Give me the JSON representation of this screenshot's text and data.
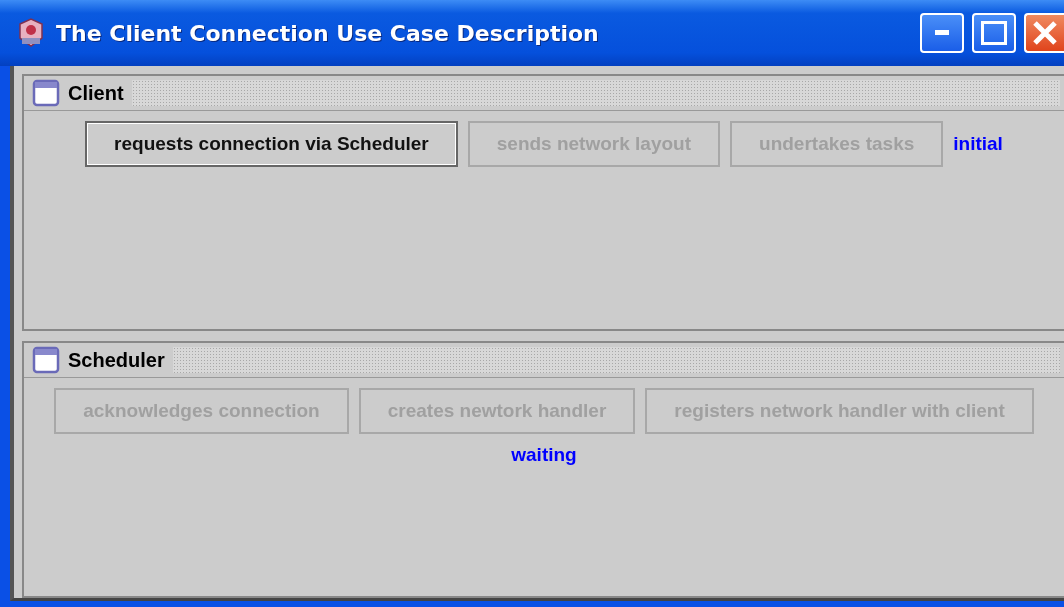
{
  "window": {
    "title": "The Client Connection Use Case Description"
  },
  "frames": [
    {
      "title": "Client",
      "status": "initial",
      "buttons": [
        {
          "label": "requests connection via Scheduler",
          "disabled": false
        },
        {
          "label": "sends network layout",
          "disabled": true
        },
        {
          "label": "undertakes tasks",
          "disabled": true
        }
      ]
    },
    {
      "title": "Scheduler",
      "status": "waiting",
      "buttons": [
        {
          "label": "acknowledges connection",
          "disabled": true
        },
        {
          "label": "creates newtork handler",
          "disabled": true
        },
        {
          "label": "registers network handler with client",
          "disabled": true
        }
      ]
    }
  ]
}
